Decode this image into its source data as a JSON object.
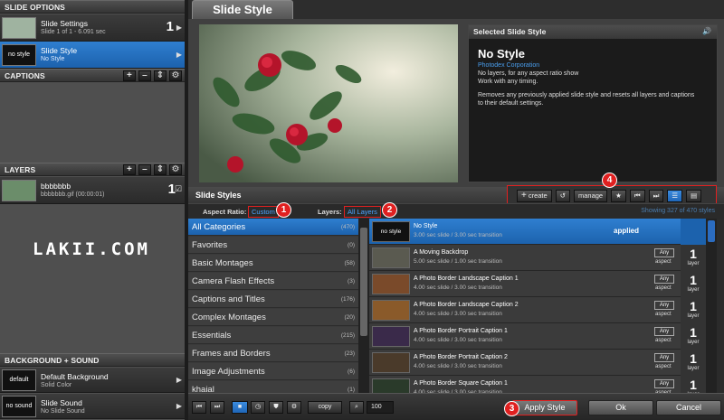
{
  "left": {
    "slide_options": {
      "title": "SLIDE OPTIONS",
      "items": [
        {
          "title": "Slide Settings",
          "sub": "Slide 1 of 1 - 6.091 sec",
          "num": "1",
          "thumb_text": ""
        },
        {
          "title": "Slide Style",
          "sub": "No Style",
          "num": "",
          "thumb_text": "no style"
        }
      ]
    },
    "captions": {
      "title": "CAPTIONS"
    },
    "layers": {
      "title": "LAYERS",
      "items": [
        {
          "title": "bbbbbbb",
          "sub": "bbbbbbb.gif (00:00:01)",
          "num": "1"
        }
      ]
    },
    "watermark": "LAKII.COM",
    "background_sound": {
      "title": "BACKGROUND + SOUND",
      "items": [
        {
          "title": "Default Background",
          "sub": "Solid Color",
          "thumb_text": "default"
        },
        {
          "title": "Slide Sound",
          "sub": "No Slide Sound",
          "thumb_text": "no sound"
        }
      ]
    }
  },
  "header": {
    "tab": "Slide Style"
  },
  "selected_style": {
    "header": "Selected Slide Style",
    "name": "No Style",
    "company": "Photodex Corporation",
    "line1": "No layers, for any aspect ratio show",
    "line2": "Work with any timing.",
    "desc1": "Removes any previously applied slide style and resets all layers and captions",
    "desc2": "to their default settings."
  },
  "toolbar": {
    "create": "create",
    "manage": "manage",
    "badge": "4"
  },
  "slide_styles": {
    "title": "Slide Styles",
    "aspect_label": "Aspect Ratio:",
    "aspect_value": "Custom",
    "aspect_badge": "1",
    "layers_label": "Layers:",
    "layers_value": "All Layers",
    "layers_badge": "2",
    "showing": "Showing 327 of 470 styles"
  },
  "categories": [
    {
      "name": "All Categories",
      "count": "(470)"
    },
    {
      "name": "Favorites",
      "count": "(0)"
    },
    {
      "name": "Basic Montages",
      "count": "(58)"
    },
    {
      "name": "Camera Flash Effects",
      "count": "(3)"
    },
    {
      "name": "Captions and Titles",
      "count": "(176)"
    },
    {
      "name": "Complex Montages",
      "count": "(20)"
    },
    {
      "name": "Essentials",
      "count": "(215)"
    },
    {
      "name": "Frames and Borders",
      "count": "(23)"
    },
    {
      "name": "Image Adjustments",
      "count": "(6)"
    },
    {
      "name": "khaial",
      "count": "(1)"
    }
  ],
  "styles": [
    {
      "name": "No Style",
      "sub": "3.00 sec slide / 3.00 sec transition",
      "thumb": "no style",
      "status": "applied",
      "any": "",
      "aspect": "",
      "layers": "",
      "layer_label": ""
    },
    {
      "name": "A Moving Backdrop",
      "sub": "5.00 sec slide / 1.00 sec transition",
      "thumb": "",
      "status": "",
      "any": "Any",
      "aspect": "aspect",
      "layers": "1",
      "layer_label": "layer"
    },
    {
      "name": "A Photo Border Landscape Caption 1",
      "sub": "4.00 sec slide / 3.00 sec transition",
      "thumb": "",
      "status": "",
      "any": "Any",
      "aspect": "aspect",
      "layers": "1",
      "layer_label": "layer"
    },
    {
      "name": "A Photo Border Landscape Caption 2",
      "sub": "4.00 sec slide / 3.00 sec transition",
      "thumb": "",
      "status": "",
      "any": "Any",
      "aspect": "aspect",
      "layers": "1",
      "layer_label": "layer"
    },
    {
      "name": "A Photo Border Portrait Caption 1",
      "sub": "4.00 sec slide / 3.00 sec transition",
      "thumb": "",
      "status": "",
      "any": "Any",
      "aspect": "aspect",
      "layers": "1",
      "layer_label": "layer"
    },
    {
      "name": "A Photo Border Portrait Caption 2",
      "sub": "4.00 sec slide / 3.00 sec transition",
      "thumb": "",
      "status": "",
      "any": "Any",
      "aspect": "aspect",
      "layers": "1",
      "layer_label": "layer"
    },
    {
      "name": "A Photo Border Square Caption 1",
      "sub": "4.00 sec slide / 3.00 sec transition",
      "thumb": "",
      "status": "",
      "any": "Any",
      "aspect": "aspect",
      "layers": "1",
      "layer_label": "layer"
    }
  ],
  "bottom": {
    "copy": "copy",
    "zoom": "100",
    "apply": "Apply Style",
    "apply_badge": "3",
    "ok": "Ok",
    "cancel": "Cancel"
  },
  "colors": {
    "accent": "#1f6fc6",
    "highlight": "#e02020"
  }
}
